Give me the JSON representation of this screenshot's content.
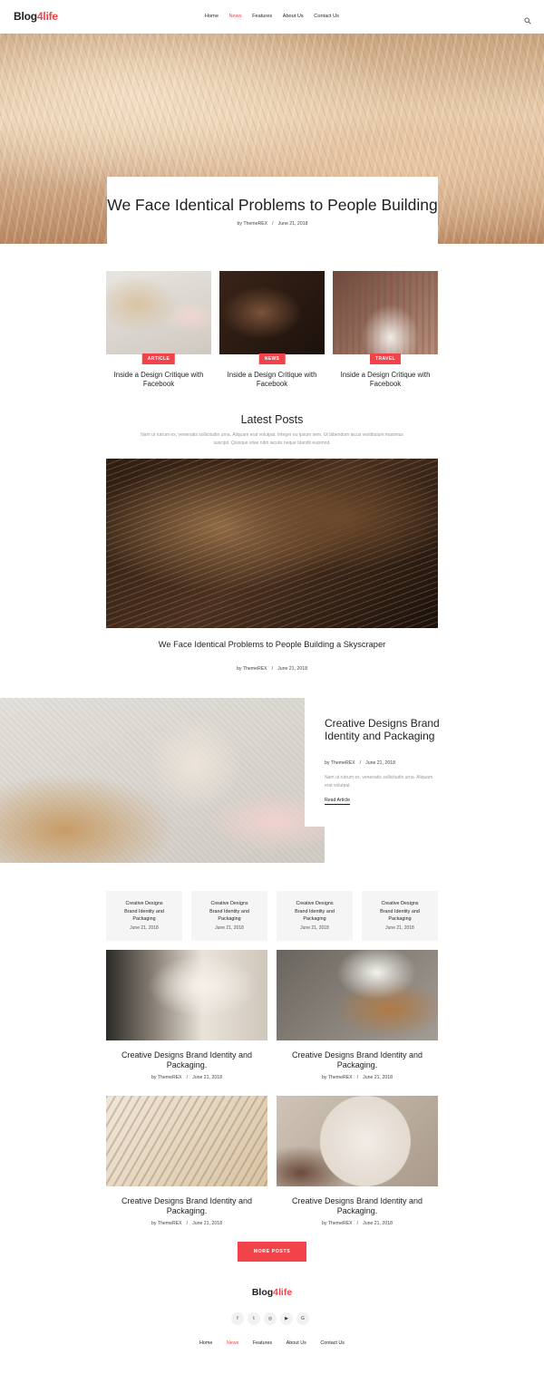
{
  "header": {
    "logo_main": "Blog",
    "logo_accent": "4life",
    "nav": [
      {
        "label": "Home",
        "active": false
      },
      {
        "label": "News",
        "active": true
      },
      {
        "label": "Features",
        "active": false
      },
      {
        "label": "About Us",
        "active": false
      },
      {
        "label": "Contact Us",
        "active": false
      }
    ],
    "search_icon": "search-icon"
  },
  "hero": {
    "title": "We Face Identical Problems to People Building",
    "author": "by ThemeREX",
    "separator": "/",
    "date": "June 21, 2018"
  },
  "category_cards": [
    {
      "tag": "ARTICLE",
      "title": "Inside a Design Critique with Facebook"
    },
    {
      "tag": "NEWS",
      "title": "Inside a Design Critique with Facebook"
    },
    {
      "tag": "TRAVEL",
      "title": "Inside a Design Critique with Facebook"
    }
  ],
  "latest": {
    "heading": "Latest Posts",
    "description": "Nam ut rutrum ex, venenatis sollicitudin urna. Aliquam erat volutpat. Integer eu ipsum sem. Ut bibendum lacus vestibulum maximus suscipit. Quisque vitae nibh iaculis neque blandit euismod.",
    "featured_title": "We Face Identical Problems to People Building a Skyscraper",
    "featured_author": "by ThemeREX",
    "featured_separator": "/",
    "featured_date": "June 21, 2018"
  },
  "feature": {
    "title": "Creative Designs Brand Identity and Packaging",
    "author": "by ThemeREX",
    "separator": "/",
    "date": "June 21, 2018",
    "description": "Nam ut rutrum ex, venenatis sollicitudin urna. Aliquam erat volutpat.",
    "link": "Read Article"
  },
  "mini_posts": [
    {
      "title": "Creative Designs Brand Identity and Packaging",
      "date": "June 21, 2018"
    },
    {
      "title": "Creative Designs Brand Identity and Packaging",
      "date": "June 21, 2018"
    },
    {
      "title": "Creative Designs Brand Identity and Packaging",
      "date": "June 21, 2018"
    },
    {
      "title": "Creative Designs Brand Identity and Packaging",
      "date": "June 21, 2018"
    }
  ],
  "grid_posts": [
    {
      "title": "Creative Designs Brand Identity and Packaging.",
      "author": "by ThemeREX",
      "separator": "/",
      "date": "June 21, 2018"
    },
    {
      "title": "Creative Designs Brand Identity and Packaging.",
      "author": "by ThemeREX",
      "separator": "/",
      "date": "June 21, 2018"
    },
    {
      "title": "Creative Designs Brand Identity and Packaging.",
      "author": "by ThemeREX",
      "separator": "/",
      "date": "June 21, 2018"
    },
    {
      "title": "Creative Designs Brand Identity and Packaging.",
      "author": "by ThemeREX",
      "separator": "/",
      "date": "June 21, 2018"
    }
  ],
  "more_button": "MORE POSTS",
  "footer": {
    "logo_main": "Blog",
    "logo_accent": "4life",
    "social": [
      {
        "glyph": "f",
        "icon": "facebook-icon"
      },
      {
        "glyph": "t",
        "icon": "twitter-icon"
      },
      {
        "glyph": "◎",
        "icon": "instagram-icon"
      },
      {
        "glyph": "▶",
        "icon": "youtube-icon"
      },
      {
        "glyph": "G",
        "icon": "google-plus-icon"
      }
    ],
    "nav": [
      {
        "label": "Home",
        "active": false
      },
      {
        "label": "News",
        "active": true
      },
      {
        "label": "Features",
        "active": false
      },
      {
        "label": "About Us",
        "active": false
      },
      {
        "label": "Contact Us",
        "active": false
      }
    ]
  },
  "colors": {
    "accent": "#f2434a",
    "text": "#1f1f1f",
    "muted": "#999999",
    "card_bg": "#f5f5f5"
  }
}
